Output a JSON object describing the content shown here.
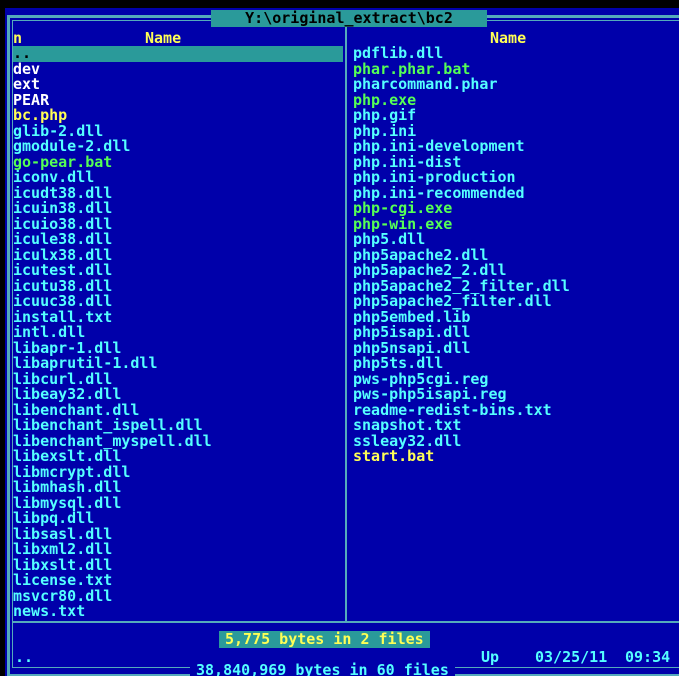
{
  "panel": {
    "path": "Y:\\original_extract\\bc2",
    "header": {
      "left_key": "n",
      "left_name": "Name",
      "right_name": "Name"
    },
    "left_files": [
      {
        "name": "..",
        "kind": "cursor"
      },
      {
        "name": "dev",
        "kind": "dir"
      },
      {
        "name": "ext",
        "kind": "dir"
      },
      {
        "name": "PEAR",
        "kind": "dir"
      },
      {
        "name": "bc.php",
        "kind": "yel"
      },
      {
        "name": "glib-2.dll",
        "kind": "file"
      },
      {
        "name": "gmodule-2.dll",
        "kind": "file"
      },
      {
        "name": "go-pear.bat",
        "kind": "exe"
      },
      {
        "name": "iconv.dll",
        "kind": "file"
      },
      {
        "name": "icudt38.dll",
        "kind": "file"
      },
      {
        "name": "icuin38.dll",
        "kind": "file"
      },
      {
        "name": "icuio38.dll",
        "kind": "file"
      },
      {
        "name": "icule38.dll",
        "kind": "file"
      },
      {
        "name": "iculx38.dll",
        "kind": "file"
      },
      {
        "name": "icutest.dll",
        "kind": "file"
      },
      {
        "name": "icutu38.dll",
        "kind": "file"
      },
      {
        "name": "icuuc38.dll",
        "kind": "file"
      },
      {
        "name": "install.txt",
        "kind": "file"
      },
      {
        "name": "intl.dll",
        "kind": "file"
      },
      {
        "name": "libapr-1.dll",
        "kind": "file"
      },
      {
        "name": "libaprutil-1.dll",
        "kind": "file"
      },
      {
        "name": "libcurl.dll",
        "kind": "file"
      },
      {
        "name": "libeay32.dll",
        "kind": "file"
      },
      {
        "name": "libenchant.dll",
        "kind": "file"
      },
      {
        "name": "libenchant_ispell.dll",
        "kind": "file"
      },
      {
        "name": "libenchant_myspell.dll",
        "kind": "file"
      },
      {
        "name": "libexslt.dll",
        "kind": "file"
      },
      {
        "name": "libmcrypt.dll",
        "kind": "file"
      },
      {
        "name": "libmhash.dll",
        "kind": "file"
      },
      {
        "name": "libmysql.dll",
        "kind": "file"
      },
      {
        "name": "libpq.dll",
        "kind": "file"
      },
      {
        "name": "libsasl.dll",
        "kind": "file"
      },
      {
        "name": "libxml2.dll",
        "kind": "file"
      },
      {
        "name": "libxslt.dll",
        "kind": "file"
      },
      {
        "name": "license.txt",
        "kind": "file"
      },
      {
        "name": "msvcr80.dll",
        "kind": "file"
      },
      {
        "name": "news.txt",
        "kind": "file"
      }
    ],
    "right_files": [
      {
        "name": "pdflib.dll",
        "kind": "file"
      },
      {
        "name": "phar.phar.bat",
        "kind": "exe"
      },
      {
        "name": "pharcommand.phar",
        "kind": "file"
      },
      {
        "name": "php.exe",
        "kind": "exe"
      },
      {
        "name": "php.gif",
        "kind": "file"
      },
      {
        "name": "php.ini",
        "kind": "file"
      },
      {
        "name": "php.ini-development",
        "kind": "file"
      },
      {
        "name": "php.ini-dist",
        "kind": "file"
      },
      {
        "name": "php.ini-production",
        "kind": "file"
      },
      {
        "name": "php.ini-recommended",
        "kind": "file"
      },
      {
        "name": "php-cgi.exe",
        "kind": "exe"
      },
      {
        "name": "php-win.exe",
        "kind": "exe"
      },
      {
        "name": "php5.dll",
        "kind": "file"
      },
      {
        "name": "php5apache2.dll",
        "kind": "file"
      },
      {
        "name": "php5apache2_2.dll",
        "kind": "file"
      },
      {
        "name": "php5apache2_2_filter.dll",
        "kind": "file"
      },
      {
        "name": "php5apache2_filter.dll",
        "kind": "file"
      },
      {
        "name": "php5embed.lib",
        "kind": "file"
      },
      {
        "name": "php5isapi.dll",
        "kind": "file"
      },
      {
        "name": "php5nsapi.dll",
        "kind": "file"
      },
      {
        "name": "php5ts.dll",
        "kind": "file"
      },
      {
        "name": "pws-php5cgi.reg",
        "kind": "file"
      },
      {
        "name": "pws-php5isapi.reg",
        "kind": "file"
      },
      {
        "name": "readme-redist-bins.txt",
        "kind": "file"
      },
      {
        "name": "snapshot.txt",
        "kind": "file"
      },
      {
        "name": "ssleay32.dll",
        "kind": "file"
      },
      {
        "name": "start.bat",
        "kind": "yel"
      }
    ],
    "selected_summary": "5,775 bytes in 2 files",
    "status": {
      "name": "..",
      "kind": "Up",
      "date": "03/25/11",
      "time": "09:34"
    },
    "total_summary": "38,840,969 bytes in 60 files"
  },
  "colors": {
    "panel_bg": "#0000aa",
    "frame": "#55aabb",
    "cursor_bg": "#2a9a9a",
    "file": "#55ffff",
    "dir": "#ffffff",
    "exe": "#55ff55",
    "highlight": "#ffff55"
  }
}
